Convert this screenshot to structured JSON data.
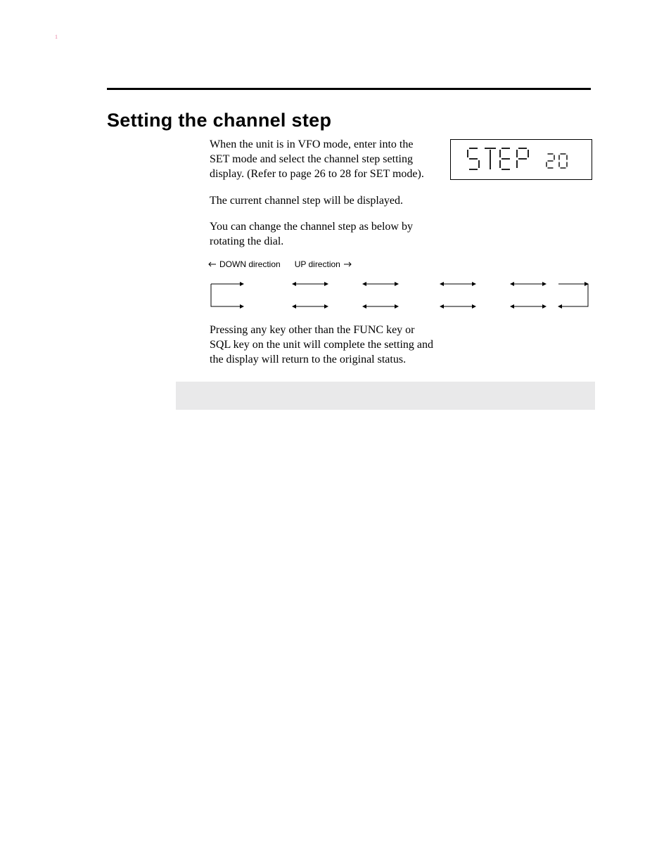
{
  "pageMark": "1",
  "heading": "Setting the channel step",
  "paragraphs": {
    "p1": "When the unit is in VFO mode, enter into the SET mode and select the channel step setting display. (Refer to page 26 to 28 for SET mode).",
    "p2": "The current channel step will be displayed.",
    "p3": "You can change the channel step as below by rotating the dial.",
    "p4": "Pressing any key other than the FUNC key or SQL key on the unit will complete the setting and the display will return to the original status."
  },
  "lcd": {
    "label": "STEP",
    "value": "20"
  },
  "directions": {
    "down": "DOWN direction",
    "up": "UP direction"
  }
}
